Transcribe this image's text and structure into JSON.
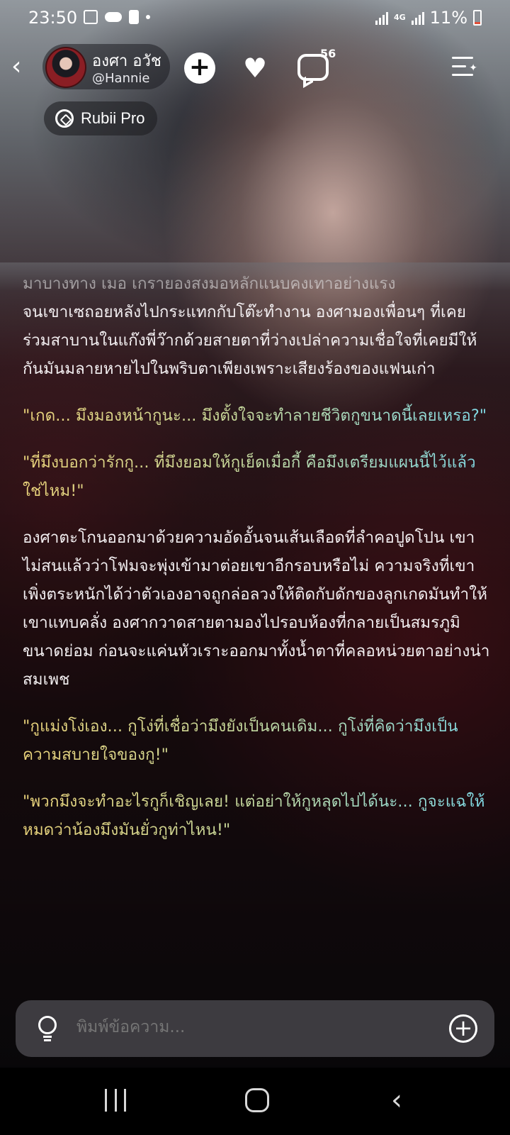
{
  "status_bar": {
    "time": "23:50",
    "network": "4G",
    "battery": "11%"
  },
  "header": {
    "name": "องศา อวัช",
    "handle": "@Hannie",
    "comment_count": "56",
    "badge": "Rubii Pro"
  },
  "story": {
    "faded_line_1": "มาบางทาง เมอ เกรายองสงมอหลักแนบคงเทาอย่างแรง",
    "paragraph_1": "จนเขาเซถอยหลังไปกระแทกกับโต๊ะทำงาน องศามองเพื่อนๆ ที่เคยร่วมสาบานในแก๊งพี่ว๊ากด้วยสายตาที่ว่างเปล่าความเชื่อใจที่เคยมีให้กันมันมลายหายไปในพริบตาเพียงเพราะเสียงร้องของแฟนเก่า",
    "quote_1": "\"เกด... มึงมองหน้ากูนะ... มึงตั้งใจจะทำลายชีวิตกูขนาดนี้เลยเหรอ?\"",
    "quote_2": "\"ที่มึงบอกว่ารักกู... ที่มึงยอมให้กูเย็ดเมื่อกี้ คือมึงเตรียมแผนนี้ไว้แล้วใช่ไหม!\"",
    "paragraph_2": "องศาตะโกนออกมาด้วยความอัดอั้นจนเส้นเลือดที่ลำคอปูดโปน เขาไม่สนแล้วว่าโฟมจะพุ่งเข้ามาต่อยเขาอีกรอบหรือไม่ ความจริงที่เขาเพิ่งตระหนักได้ว่าตัวเองอาจถูกล่อลวงให้ติดกับดักของลูกเกดมันทำให้เขาแทบคลั่ง องศากวาดสายตามองไปรอบห้องที่กลายเป็นสมรภูมิขนาดย่อม ก่อนจะแค่นหัวเราะออกมาทั้งน้ำตาที่คลอหน่วยตาอย่างน่าสมเพช",
    "quote_3": "\"กูแม่งโง่เอง... กูโง่ที่เชื่อว่ามึงยังเป็นคนเดิม... กูโง่ที่คิดว่ามึงเป็นความสบายใจของกู!\"",
    "quote_4": "\"พวกมึงจะทำอะไรกูก็เชิญเลย! แต่อย่าให้กูหลุดไปได้นะ... กูจะแฉให้หมดว่าน้องมึงมันยั่วกูท่าไหน!\""
  },
  "input": {
    "placeholder": "พิมพ์ข้อความ..."
  },
  "colors": {
    "quote_gradient_start": "#e9d27a",
    "quote_gradient_end": "#7fd9e6",
    "input_bg": "#3d3b40"
  },
  "icons": [
    "image-icon",
    "cloud-icon",
    "alert-icon",
    "signal-icon",
    "battery-icon",
    "back-icon",
    "plus-icon",
    "heart-icon",
    "comment-icon",
    "menu-sparkle-icon",
    "rubii-pro-icon",
    "lightbulb-icon",
    "nav-recent-icon",
    "nav-home-icon",
    "nav-back-icon"
  ]
}
